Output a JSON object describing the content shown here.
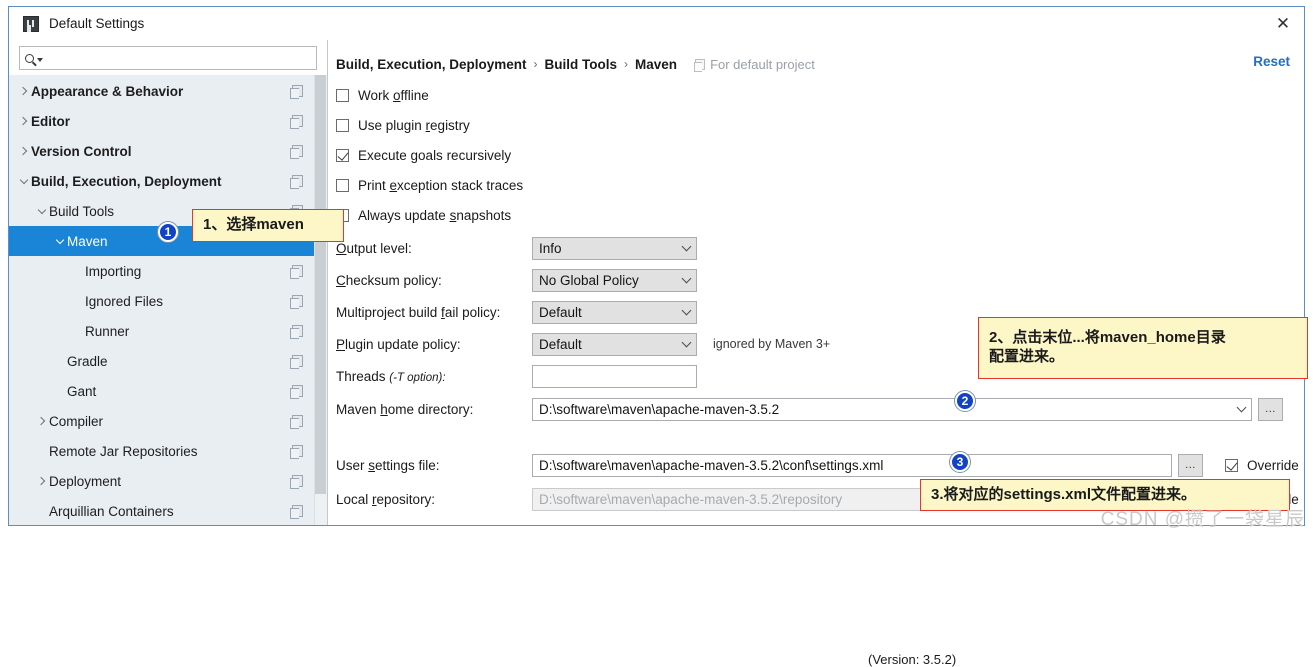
{
  "window": {
    "title": "Default Settings",
    "app_icon": "intellij-icon",
    "close_icon": "close-icon"
  },
  "sidebar": {
    "search": {
      "placeholder": "",
      "value": "",
      "icon": "search-icon"
    },
    "items": [
      {
        "label": "Appearance & Behavior",
        "depth": 0,
        "arrow": "right",
        "bold": true,
        "selected": false,
        "copy": true
      },
      {
        "label": "Editor",
        "depth": 0,
        "arrow": "right",
        "bold": true,
        "selected": false,
        "copy": true
      },
      {
        "label": "Version Control",
        "depth": 0,
        "arrow": "right",
        "bold": true,
        "selected": false,
        "copy": true
      },
      {
        "label": "Build, Execution, Deployment",
        "depth": 0,
        "arrow": "down",
        "bold": true,
        "selected": false,
        "copy": true
      },
      {
        "label": "Build Tools",
        "depth": 1,
        "arrow": "down",
        "bold": false,
        "selected": false,
        "copy": true
      },
      {
        "label": "Maven",
        "depth": 2,
        "arrow": "down",
        "bold": false,
        "selected": true,
        "copy": false
      },
      {
        "label": "Importing",
        "depth": 3,
        "arrow": "none",
        "bold": false,
        "selected": false,
        "copy": true
      },
      {
        "label": "Ignored Files",
        "depth": 3,
        "arrow": "none",
        "bold": false,
        "selected": false,
        "copy": true
      },
      {
        "label": "Runner",
        "depth": 3,
        "arrow": "none",
        "bold": false,
        "selected": false,
        "copy": true
      },
      {
        "label": "Gradle",
        "depth": 2,
        "arrow": "none",
        "bold": false,
        "selected": false,
        "copy": true
      },
      {
        "label": "Gant",
        "depth": 2,
        "arrow": "none",
        "bold": false,
        "selected": false,
        "copy": true
      },
      {
        "label": "Compiler",
        "depth": 1,
        "arrow": "right",
        "bold": false,
        "selected": false,
        "copy": true
      },
      {
        "label": "Remote Jar Repositories",
        "depth": 1,
        "arrow": "none",
        "bold": false,
        "selected": false,
        "copy": true
      },
      {
        "label": "Deployment",
        "depth": 1,
        "arrow": "right",
        "bold": false,
        "selected": false,
        "copy": true
      },
      {
        "label": "Arquillian Containers",
        "depth": 1,
        "arrow": "none",
        "bold": false,
        "selected": false,
        "copy": true
      }
    ]
  },
  "header": {
    "breadcrumb": [
      "Build, Execution, Deployment",
      "Build Tools",
      "Maven"
    ],
    "separator": "›",
    "scope_note": "For default project",
    "scope_icon": "copy-icon",
    "reset_label": "Reset"
  },
  "checkboxes": [
    {
      "label": "Work offline",
      "mnemonic": "o",
      "checked": false
    },
    {
      "label": "Use plugin registry",
      "mnemonic": "r",
      "checked": false
    },
    {
      "label": "Execute goals recursively",
      "mnemonic": "g",
      "checked": true
    },
    {
      "label": "Print exception stack traces",
      "mnemonic": "e",
      "checked": false
    },
    {
      "label": "Always update snapshots",
      "mnemonic": "s",
      "checked": false
    }
  ],
  "fields": {
    "output_level": {
      "label": "Output level:",
      "mnemonic": "l",
      "value": "Info"
    },
    "checksum_policy": {
      "label": "Checksum policy:",
      "mnemonic": "C",
      "value": "No Global Policy"
    },
    "fail_policy": {
      "label": "Multiproject build fail policy:",
      "mnemonic": "f",
      "value": "Default"
    },
    "plugin_policy": {
      "label": "Plugin update policy:",
      "mnemonic": "P",
      "value": "Default",
      "note": "ignored by Maven 3+"
    },
    "threads": {
      "label": "Threads",
      "suffix": "(-T option):",
      "value": ""
    },
    "maven_home": {
      "label": "Maven home directory:",
      "mnemonic": "h",
      "value": "D:\\software\\maven\\apache-maven-3.5.2",
      "browse": "..."
    },
    "version_line": "(Version: 3.5.2)",
    "user_settings": {
      "label": "User settings file:",
      "mnemonic": "s",
      "value": "D:\\software\\maven\\apache-maven-3.5.2\\conf\\settings.xml",
      "browse": "...",
      "override_label": "Override",
      "override_checked": true
    },
    "local_repo": {
      "label": "Local repository:",
      "mnemonic": "r",
      "value": "D:\\software\\maven\\apache-maven-3.5.2\\repository",
      "browse": "...",
      "override_label": "Override",
      "override_checked": false,
      "disabled": true
    }
  },
  "annotations": {
    "badges": [
      "1",
      "2",
      "3"
    ],
    "callout1": "1、选择maven",
    "callout2": "2、点击末位...将maven_home目录\n配置进来。",
    "callout2_line1": "2、点击末位...将maven_home目录",
    "callout2_line2": "配置进来。",
    "callout3": "3.将对应的settings.xml文件配置进来。",
    "callout_bg": "#fdf7c8",
    "callout_border": "#e8352b",
    "badge_color": "#1143c4"
  },
  "watermark": "CSDN @攒了一袋星辰"
}
